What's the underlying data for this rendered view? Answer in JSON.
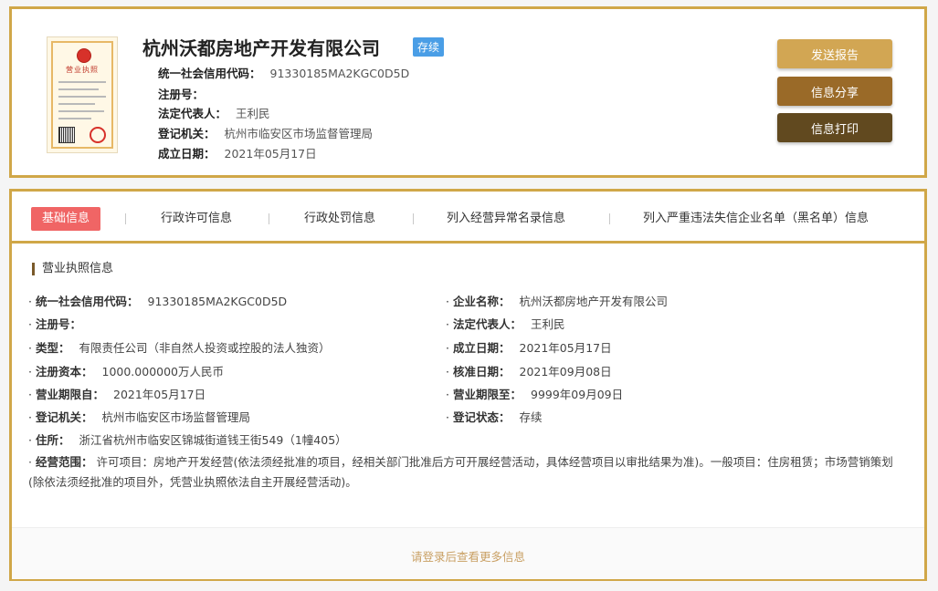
{
  "header": {
    "company_name": "杭州沃都房地产开发有限公司",
    "status": "存续",
    "license_image_title": "营业执照",
    "fields": [
      {
        "label": "统一社会信用代码：",
        "value": "91330185MA2KGC0D5D"
      },
      {
        "label": "注册号：",
        "value": ""
      },
      {
        "label": "法定代表人：",
        "value": "王利民"
      },
      {
        "label": "登记机关：",
        "value": "杭州市临安区市场监督管理局"
      },
      {
        "label": "成立日期：",
        "value": "2021年05月17日"
      }
    ],
    "buttons": {
      "report": "发送报告",
      "share": "信息分享",
      "print": "信息打印"
    }
  },
  "tabs": [
    {
      "label": "基础信息",
      "active": true
    },
    {
      "label": "行政许可信息",
      "active": false
    },
    {
      "label": "行政处罚信息",
      "active": false
    },
    {
      "label": "列入经营异常名录信息",
      "active": false
    },
    {
      "label": "列入严重违法失信企业名单（黑名单）信息",
      "active": false
    }
  ],
  "section": {
    "title": "营业执照信息",
    "bullet": "·",
    "left_fields": [
      {
        "label": "统一社会信用代码：",
        "value": "91330185MA2KGC0D5D"
      },
      {
        "label": "注册号：",
        "value": ""
      },
      {
        "label": "类型：",
        "value": "有限责任公司（非自然人投资或控股的法人独资）"
      },
      {
        "label": "注册资本：",
        "value": "1000.000000万人民币"
      },
      {
        "label": "营业期限自：",
        "value": "2021年05月17日"
      },
      {
        "label": "登记机关：",
        "value": "杭州市临安区市场监督管理局"
      },
      {
        "label": "住所：",
        "value": "浙江省杭州市临安区锦城街道钱王街549（1幢405）"
      }
    ],
    "right_fields": [
      {
        "label": "企业名称：",
        "value": "杭州沃都房地产开发有限公司"
      },
      {
        "label": "法定代表人：",
        "value": "王利民"
      },
      {
        "label": "成立日期：",
        "value": "2021年05月17日"
      },
      {
        "label": "核准日期：",
        "value": "2021年09月08日"
      },
      {
        "label": "营业期限至：",
        "value": "9999年09月09日"
      },
      {
        "label": "登记状态：",
        "value": "存续"
      }
    ],
    "scope": {
      "label": "经营范围：",
      "value": "许可项目：房地产开发经营(依法须经批准的项目，经相关部门批准后方可开展经营活动，具体经营项目以审批结果为准)。一般项目：住房租赁；市场营销策划(除依法须经批准的项目外，凭营业执照依法自主开展经营活动)。"
    }
  },
  "footer": {
    "login_tip": "请登录后查看更多信息"
  },
  "colors": {
    "border": "#d0a748",
    "active_tab": "#f06565",
    "status_badge": "#4a9ee6",
    "btn_report": "#d2a653",
    "btn_share": "#9a6a28",
    "btn_print": "#61491f"
  },
  "icons": {
    "license": "business-license-icon"
  }
}
